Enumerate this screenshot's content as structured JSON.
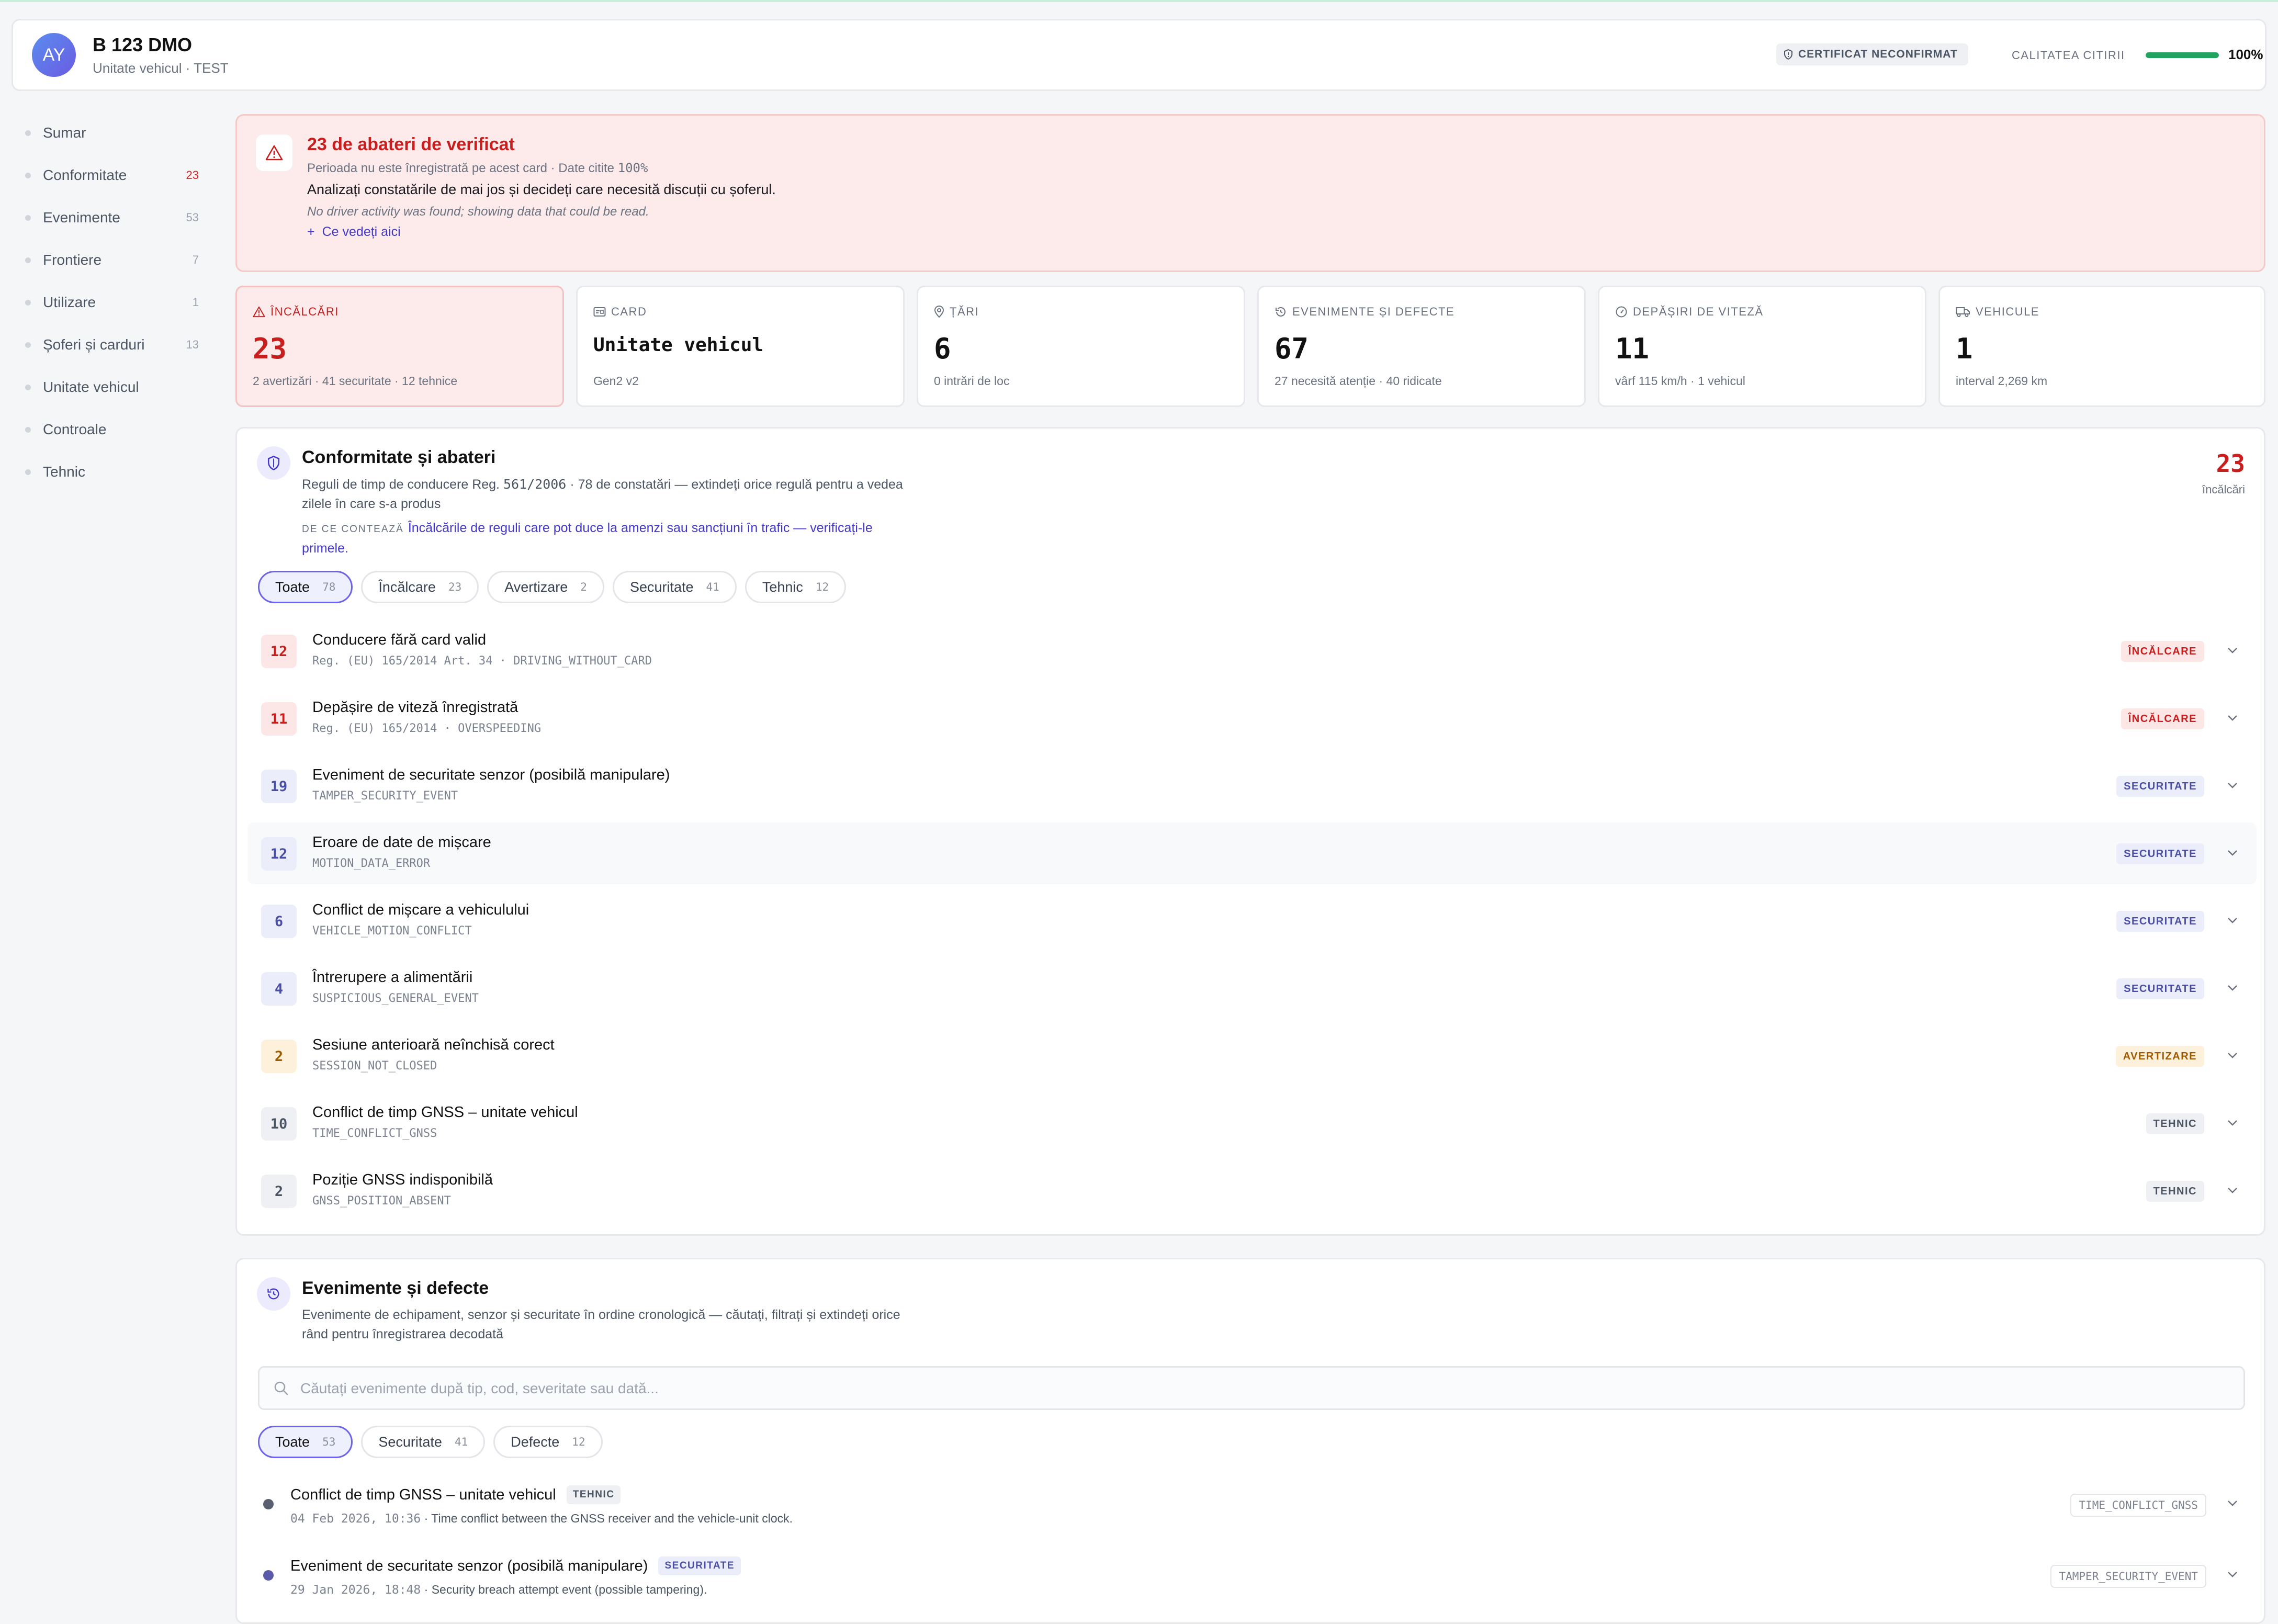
{
  "header": {
    "avatar_initials": "AY",
    "title": "B 123 DMO",
    "subtitle": "Unitate vehicul · TEST",
    "certificate_badge": "CERTIFICAT NECONFIRMAT",
    "quality_label": "CALITATEA CITIRII",
    "quality_value": "100%",
    "quality_fraction": 1.0
  },
  "sidebar": {
    "items": [
      {
        "label": "Sumar",
        "count": "",
        "active": true
      },
      {
        "label": "Conformitate",
        "count": "23",
        "active": false
      },
      {
        "label": "Evenimente",
        "count": "53",
        "active": false
      },
      {
        "label": "Frontiere",
        "count": "7",
        "active": false
      },
      {
        "label": "Utilizare",
        "count": "1",
        "active": false
      },
      {
        "label": "Șoferi și carduri",
        "count": "13",
        "active": false
      },
      {
        "label": "Unitate vehicul",
        "count": "",
        "active": false
      },
      {
        "label": "Controale",
        "count": "",
        "active": false
      },
      {
        "label": "Tehnic",
        "count": "",
        "active": false
      }
    ]
  },
  "alert": {
    "title": "23 de abateri de verificat",
    "subtitle_prefix": "Perioada nu este înregistrată pe acest card · Date citite ",
    "subtitle_value": "100%",
    "body": "Analizați constatările de mai jos și decideți care necesită discuții cu șoferul.",
    "note": "No driver activity was found; showing data that could be read.",
    "link": "Ce vedeți aici"
  },
  "stats": [
    {
      "label": "Încălcări",
      "value": "23",
      "sub": "2 avertizări · 41 securitate · 12 tehnice",
      "icon": "warning-icon"
    },
    {
      "label": "Card",
      "value": "Unitate vehicul",
      "sub": "Gen2 v2",
      "icon": "card-icon"
    },
    {
      "label": "Țări",
      "value": "6",
      "sub": "0 intrări de loc",
      "icon": "map-pin-icon"
    },
    {
      "label": "Evenimente și defecte",
      "value": "67",
      "sub": "27 necesită atenție · 40 ridicate",
      "icon": "history-icon"
    },
    {
      "label": "Depășiri de viteză",
      "value": "11",
      "sub": "vârf 115 km/h · 1 vehicul",
      "icon": "speedometer-icon"
    },
    {
      "label": "Vehicule",
      "value": "1",
      "sub": "interval 2,269 km",
      "icon": "truck-icon"
    }
  ],
  "compliance": {
    "title": "Conformitate și abateri",
    "desc_prefix": "Reguli de timp de conducere Reg. ",
    "desc_reg": "561/2006",
    "desc_suffix": " · 78 de constatări — extindeți orice regulă pentru a vedea zilele în care s-a produs",
    "why_label": "DE CE CONTEAZĂ",
    "why_text": "Încălcările de reguli care pot duce la amenzi sau sancțiuni în trafic — verificați-le primele.",
    "count": "23",
    "count_label": "încălcări",
    "filters": [
      {
        "label": "Toate",
        "count": "78",
        "active": true
      },
      {
        "label": "Încălcare",
        "count": "23",
        "active": false
      },
      {
        "label": "Avertizare",
        "count": "2",
        "active": false
      },
      {
        "label": "Securitate",
        "count": "41",
        "active": false
      },
      {
        "label": "Tehnic",
        "count": "12",
        "active": false
      }
    ],
    "rules": [
      {
        "num": "12",
        "title": "Conducere fără card valid",
        "code": "Reg. (EU) 165/2014 Art. 34 · DRIVING_WITHOUT_CARD",
        "tag": "ÎNCĂLCARE",
        "kind": "red"
      },
      {
        "num": "11",
        "title": "Depășire de viteză înregistrată",
        "code": "Reg. (EU) 165/2014 · OVERSPEEDING",
        "tag": "ÎNCĂLCARE",
        "kind": "red"
      },
      {
        "num": "19",
        "title": "Eveniment de securitate senzor (posibilă manipulare)",
        "code": "TAMPER_SECURITY_EVENT",
        "tag": "SECURITATE",
        "kind": "blue"
      },
      {
        "num": "12",
        "title": "Eroare de date de mișcare",
        "code": "MOTION_DATA_ERROR",
        "tag": "SECURITATE",
        "kind": "blue"
      },
      {
        "num": "6",
        "title": "Conflict de mișcare a vehiculului",
        "code": "VEHICLE_MOTION_CONFLICT",
        "tag": "SECURITATE",
        "kind": "blue"
      },
      {
        "num": "4",
        "title": "Întrerupere a alimentării",
        "code": "SUSPICIOUS_GENERAL_EVENT",
        "tag": "SECURITATE",
        "kind": "blue"
      },
      {
        "num": "2",
        "title": "Sesiune anterioară neînchisă corect",
        "code": "SESSION_NOT_CLOSED",
        "tag": "AVERTIZARE",
        "kind": "amber"
      },
      {
        "num": "10",
        "title": "Conflict de timp GNSS – unitate vehicul",
        "code": "TIME_CONFLICT_GNSS",
        "tag": "TEHNIC",
        "kind": "gray"
      },
      {
        "num": "2",
        "title": "Poziție GNSS indisponibilă",
        "code": "GNSS_POSITION_ABSENT",
        "tag": "TEHNIC",
        "kind": "gray"
      }
    ]
  },
  "events": {
    "title": "Evenimente și defecte",
    "desc": "Evenimente de echipament, senzor și securitate în ordine cronologică — căutați, filtrați și extindeți orice rând pentru înregistrarea decodată",
    "search_placeholder": "Căutați evenimente după tip, cod, severitate sau dată...",
    "filters": [
      {
        "label": "Toate",
        "count": "53",
        "active": true
      },
      {
        "label": "Securitate",
        "count": "41",
        "active": false
      },
      {
        "label": "Defecte",
        "count": "12",
        "active": false
      }
    ],
    "rows": [
      {
        "title": "Conflict de timp GNSS – unitate vehicul",
        "tag": "TEHNIC",
        "kind": "gray",
        "date": "04 Feb 2026, 10:36",
        "text": "Time conflict between the GNSS receiver and the vehicle-unit clock.",
        "code": "TIME_CONFLICT_GNSS",
        "dot": "#5b6070"
      },
      {
        "title": "Eveniment de securitate senzor (posibilă manipulare)",
        "tag": "SECURITATE",
        "kind": "blue",
        "date": "29 Jan 2026, 18:48",
        "text": "Security breach attempt event (possible tampering).",
        "code": "TAMPER_SECURITY_EVENT",
        "dot": "#5a5aa8"
      }
    ]
  }
}
